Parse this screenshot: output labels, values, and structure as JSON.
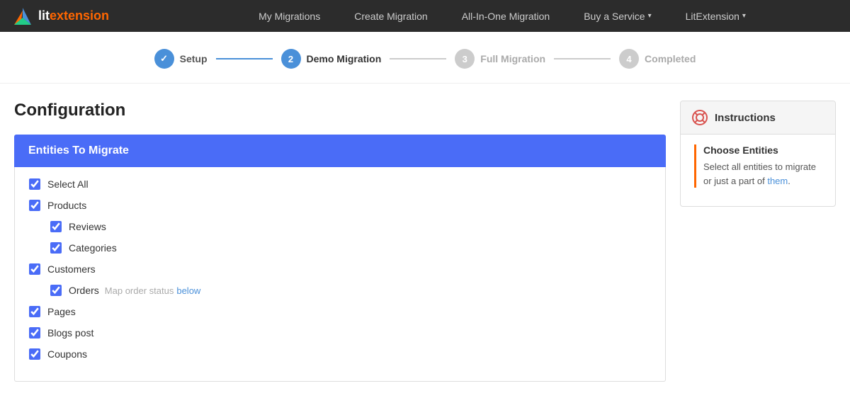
{
  "nav": {
    "logo_lit": "lit",
    "logo_ext": "extension",
    "links": [
      {
        "id": "my-migrations",
        "label": "My Migrations"
      },
      {
        "id": "create-migration",
        "label": "Create Migration"
      },
      {
        "id": "all-in-one",
        "label": "All-In-One Migration"
      },
      {
        "id": "buy-service",
        "label": "Buy a Service",
        "has_caret": true
      },
      {
        "id": "litextension",
        "label": "LitExtension",
        "has_caret": true
      }
    ]
  },
  "steps": [
    {
      "id": "setup",
      "num": "✓",
      "label": "Setup",
      "state": "done"
    },
    {
      "id": "demo-migration",
      "num": "2",
      "label": "Demo Migration",
      "state": "active"
    },
    {
      "id": "full-migration",
      "num": "3",
      "label": "Full Migration",
      "state": "inactive"
    },
    {
      "id": "completed",
      "num": "4",
      "label": "Completed",
      "state": "inactive"
    }
  ],
  "page": {
    "title": "Configuration"
  },
  "entities": {
    "header": "Entities To Migrate",
    "items": [
      {
        "id": "select-all",
        "label": "Select All",
        "checked": true,
        "indent": 0
      },
      {
        "id": "products",
        "label": "Products",
        "checked": true,
        "indent": 0
      },
      {
        "id": "reviews",
        "label": "Reviews",
        "checked": true,
        "indent": 1
      },
      {
        "id": "categories",
        "label": "Categories",
        "checked": true,
        "indent": 1
      },
      {
        "id": "customers",
        "label": "Customers",
        "checked": true,
        "indent": 0
      },
      {
        "id": "orders",
        "label": "Orders",
        "checked": true,
        "indent": 1,
        "map_text": "Map order status",
        "map_link": "below"
      },
      {
        "id": "pages",
        "label": "Pages",
        "checked": true,
        "indent": 0
      },
      {
        "id": "blogs-post",
        "label": "Blogs post",
        "checked": true,
        "indent": 0
      },
      {
        "id": "coupons",
        "label": "Coupons",
        "checked": true,
        "indent": 0
      }
    ]
  },
  "instructions": {
    "title": "Instructions",
    "section_title": "Choose Entities",
    "section_body_1": "Select all entities to migrate or just a part of ",
    "section_body_link": "them",
    "section_body_2": "."
  }
}
